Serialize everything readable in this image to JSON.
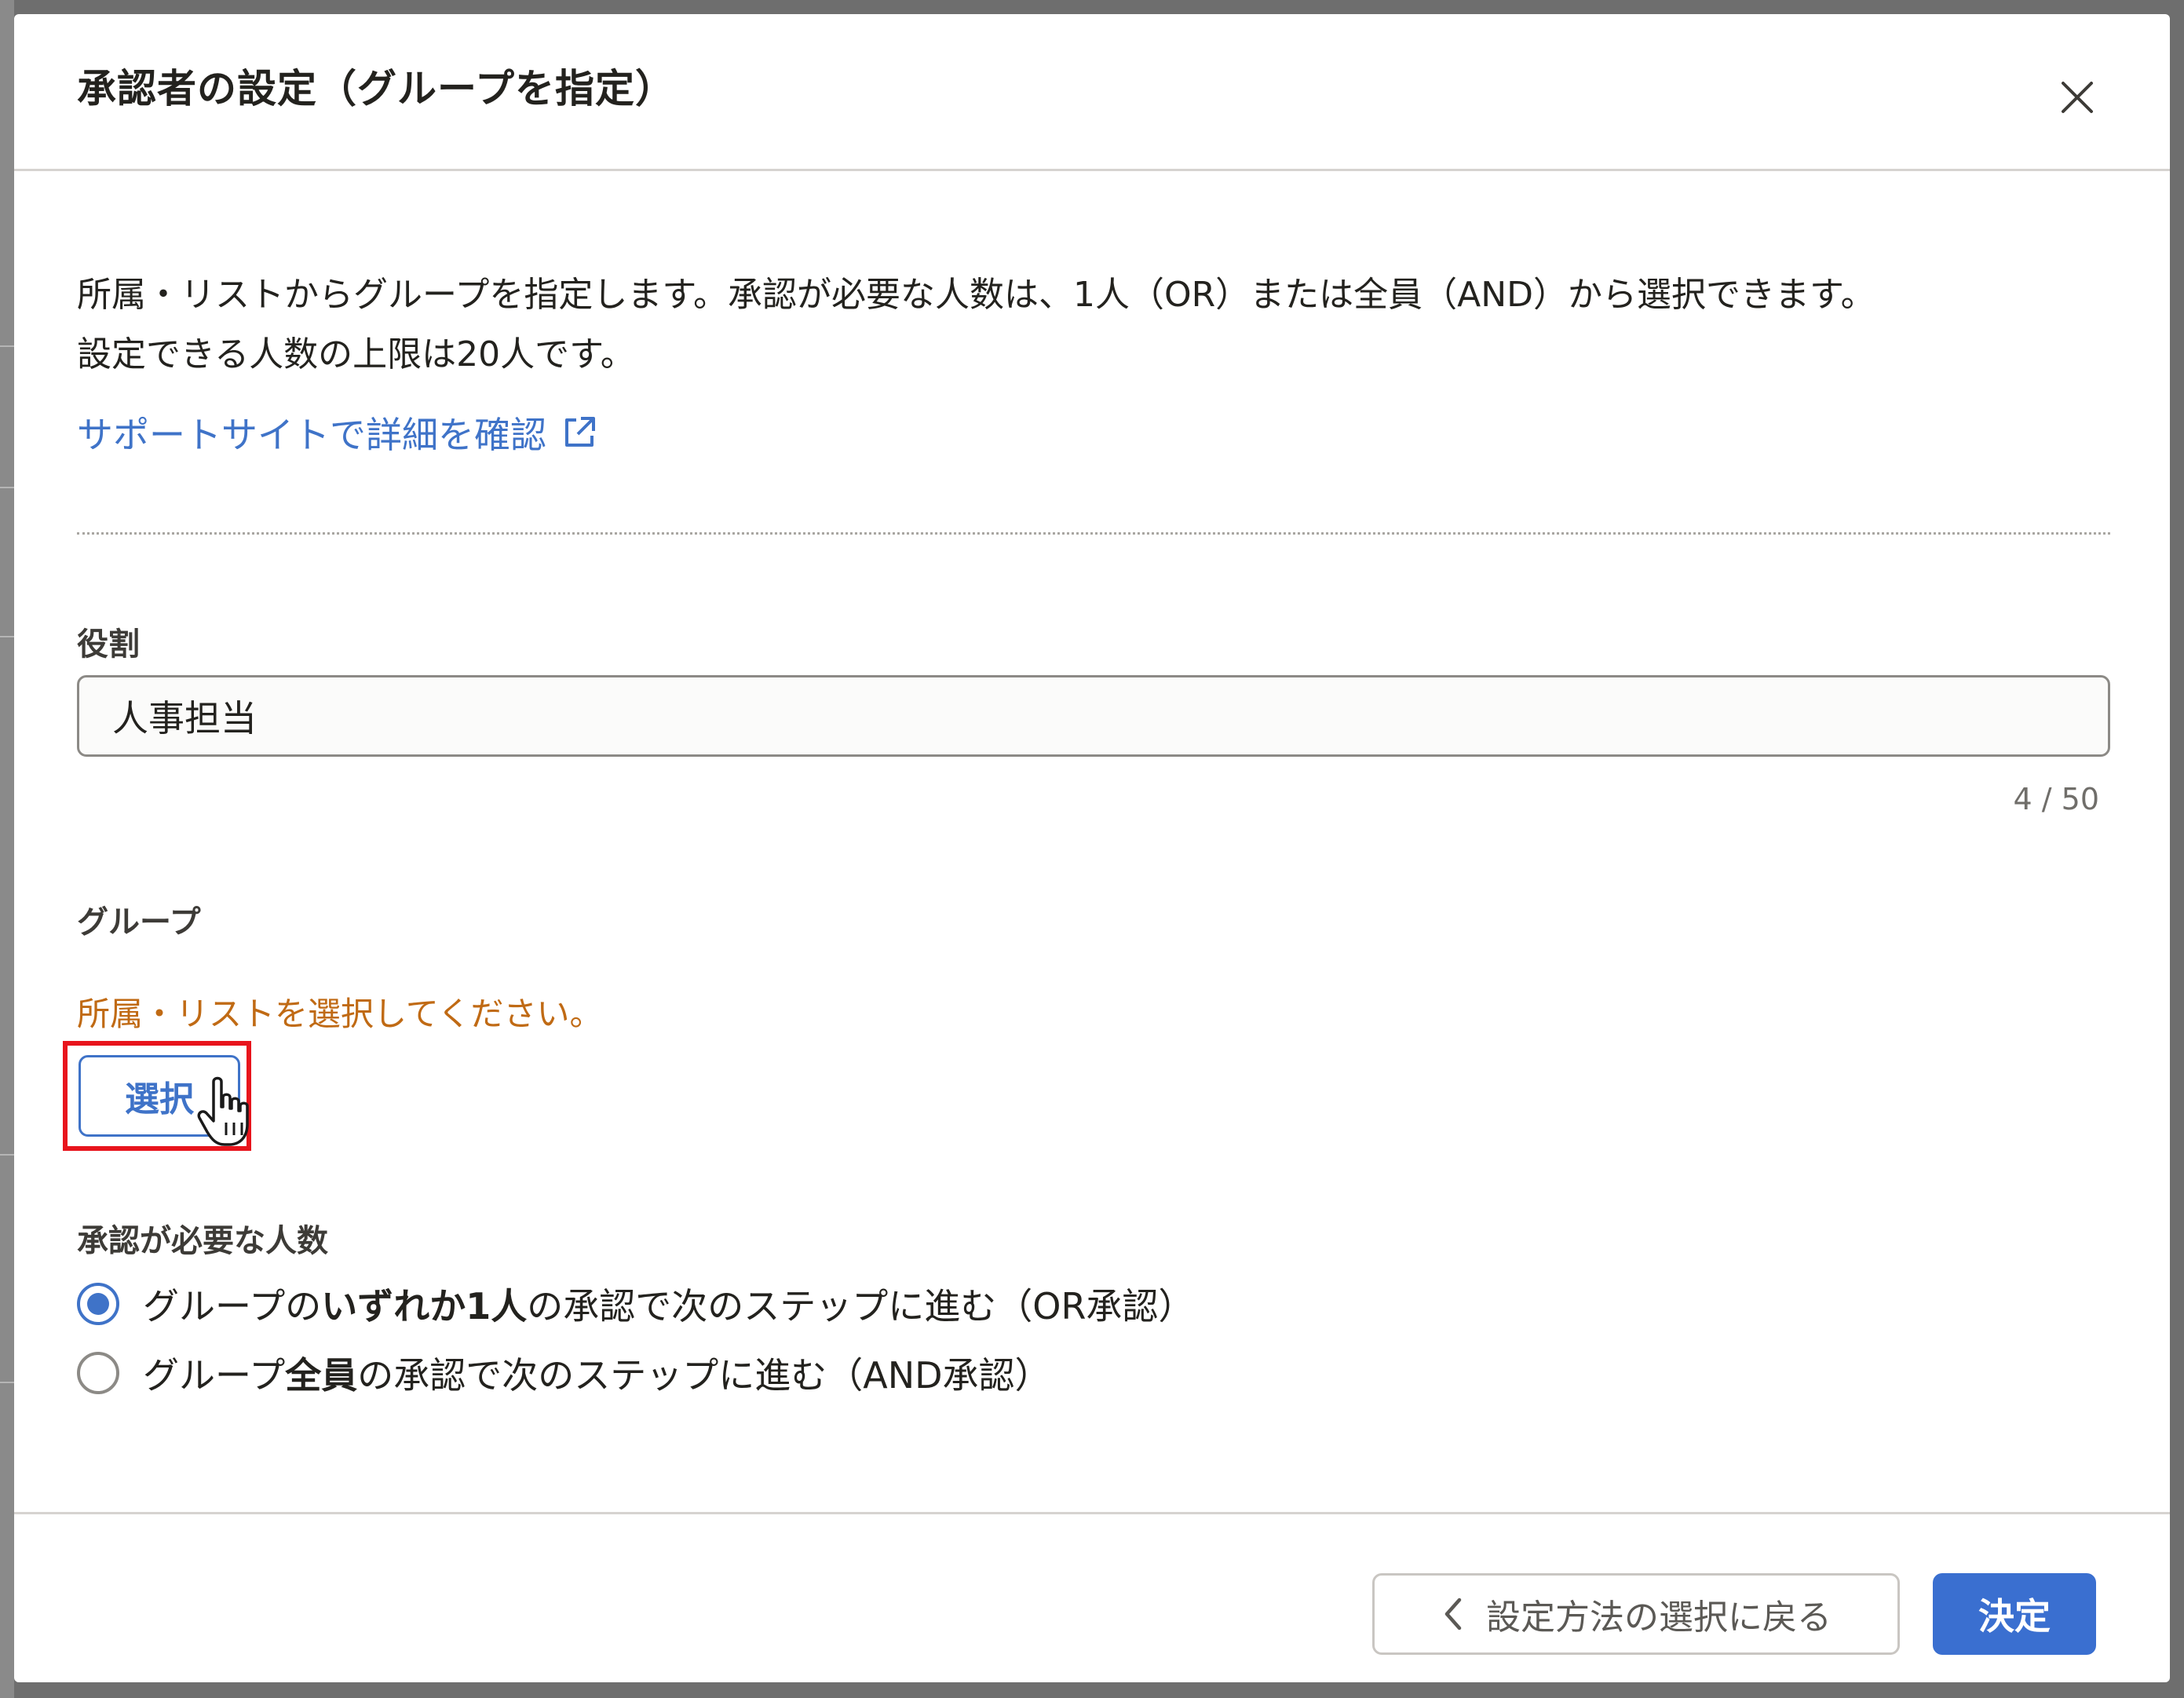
{
  "dialog": {
    "title": "承認者の設定（グループを指定）",
    "close_icon": "close-icon"
  },
  "description": {
    "line1": "所属・リストからグループを指定します。承認が必要な人数は、1人（OR）または全員（AND）から選択できます。",
    "line2": "設定できる人数の上限は20人です。"
  },
  "support_link": {
    "label": "サポートサイトで詳細を確認",
    "icon": "external-link-icon"
  },
  "role_field": {
    "label": "役割",
    "value": "人事担当",
    "char_count": "4 / 50"
  },
  "group_field": {
    "label": "グループ",
    "warning": "所属・リストを選択してください。",
    "select_button": "選択"
  },
  "approval_count": {
    "label": "承認が必要な人数",
    "options": [
      {
        "selected": true,
        "prefix": "グループの",
        "bold": "いずれか1人",
        "suffix": "の承認で次のステップに進む（OR承認）"
      },
      {
        "selected": false,
        "prefix": "グループ",
        "bold": "全員",
        "suffix": "の承認で次のステップに進む（AND承認）"
      }
    ]
  },
  "footer": {
    "back_button": "設定方法の選択に戻る",
    "confirm_button": "決定"
  },
  "colors": {
    "accent": "#3f73c8",
    "warning": "#c06a14",
    "highlight": "#e8141c"
  }
}
